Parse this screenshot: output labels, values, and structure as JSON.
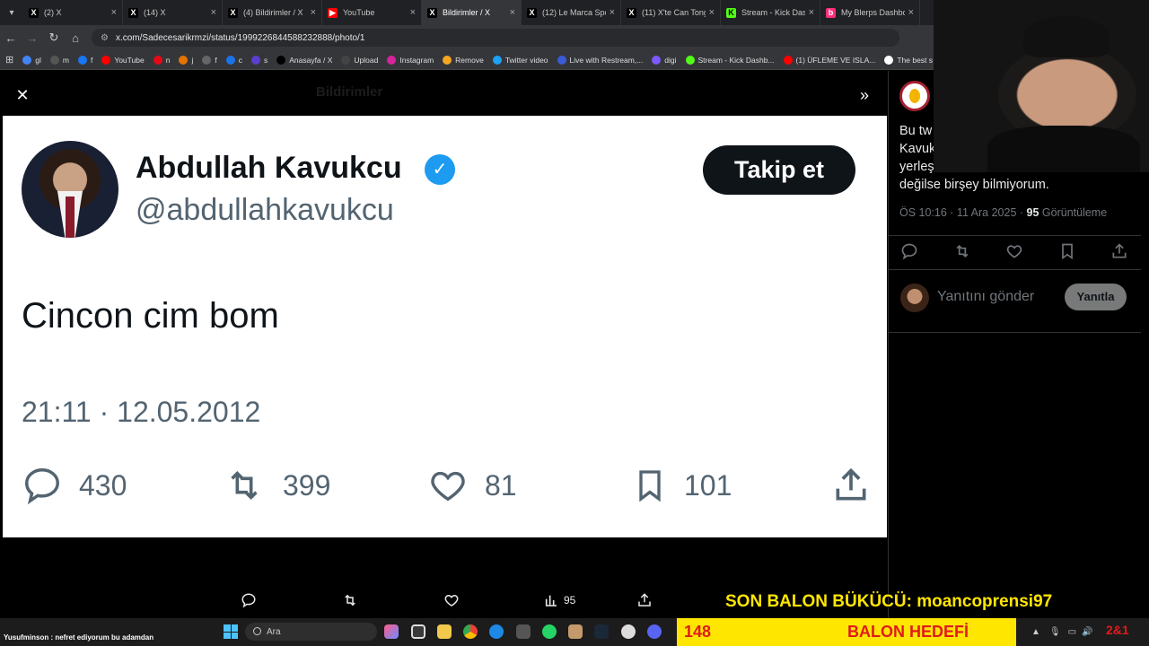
{
  "browser": {
    "tabs": [
      {
        "label": "(2) X",
        "icon": "x-icon"
      },
      {
        "label": "(14) X",
        "icon": "x-icon"
      },
      {
        "label": "(4) Bildirimler / X",
        "icon": "x-icon"
      },
      {
        "label": "YouTube",
        "icon": "youtube-icon"
      },
      {
        "label": "Bildirimler / X",
        "icon": "x-icon",
        "active": true
      },
      {
        "label": "(12) Le Marca Spo",
        "icon": "x-icon"
      },
      {
        "label": "(11) X'te Can Tong",
        "icon": "x-icon"
      },
      {
        "label": "Stream - Kick Dash",
        "icon": "kick-icon"
      },
      {
        "label": "My Blerps Dashbo",
        "icon": "blerp-icon"
      }
    ],
    "url": "x.com/Sadecesarikrmzi/status/1999226844588232888/photo/1",
    "bookmarks": [
      {
        "label": "gl",
        "color": "#4285f4"
      },
      {
        "label": "m",
        "color": "#555"
      },
      {
        "label": "f",
        "color": "#1877f2"
      },
      {
        "label": "YouTube",
        "color": "#ff0000"
      },
      {
        "label": "n",
        "color": "#e50914"
      },
      {
        "label": "j",
        "color": "#e37400"
      },
      {
        "label": "f",
        "color": "#666"
      },
      {
        "label": "c",
        "color": "#1a73e8"
      },
      {
        "label": "s",
        "color": "#5b3fd0"
      },
      {
        "label": "Anasayfa / X",
        "color": "#000"
      },
      {
        "label": "Upload",
        "color": "#444"
      },
      {
        "label": "Instagram",
        "color": "#d6249f"
      },
      {
        "label": "Remove",
        "color": "#f5a623"
      },
      {
        "label": "Twitter video",
        "color": "#1da1f2"
      },
      {
        "label": "Live with Restream,...",
        "color": "#3a5bd9"
      },
      {
        "label": "digi",
        "color": "#7a5af8"
      },
      {
        "label": "Stream - Kick Dashb...",
        "color": "#53fc18"
      },
      {
        "label": "(1) ÜFLEME VE ISLA...",
        "color": "#ff0000"
      },
      {
        "label": "The best s",
        "color": "#fff"
      }
    ]
  },
  "background": {
    "header_title": "Bildirimler"
  },
  "photo": {
    "display_name": "Abdullah Kavukcu",
    "handle": "@abdullahkavukcu",
    "follow_label": "Takip et",
    "text": "Cincon cim bom",
    "timestamp": "21:11 · 12.05.2012",
    "stats": {
      "replies": "430",
      "retweets": "399",
      "likes": "81",
      "bookmarks": "101"
    }
  },
  "side": {
    "text_lines": [
      "Bu tw",
      "Kavuk",
      "yerleş",
      "değilse birşey bilmiyorum."
    ],
    "time": "ÖS 10:16 · 11 Ara 2025 · ",
    "views_count": "95",
    "views_label": " Görüntüleme",
    "reply_placeholder": "Yanıtını gönder",
    "reply_button": "Yanıtla"
  },
  "action_bar": {
    "views": "95"
  },
  "stream_overlay": {
    "last_popper": "SON BALON BÜKÜCÜ: moancoprensi97",
    "goal_count": "148",
    "goal_label": "BALON HEDEFİ",
    "chat_message": "Yusufminson : nefret ediyorum bu adamdan",
    "tray_number": "2&1"
  },
  "taskbar": {
    "search_placeholder": "Ara"
  },
  "colors": {
    "accent": "#1d9bf0",
    "goal_bg": "#ffe600",
    "goal_text": "#e01b1b"
  }
}
